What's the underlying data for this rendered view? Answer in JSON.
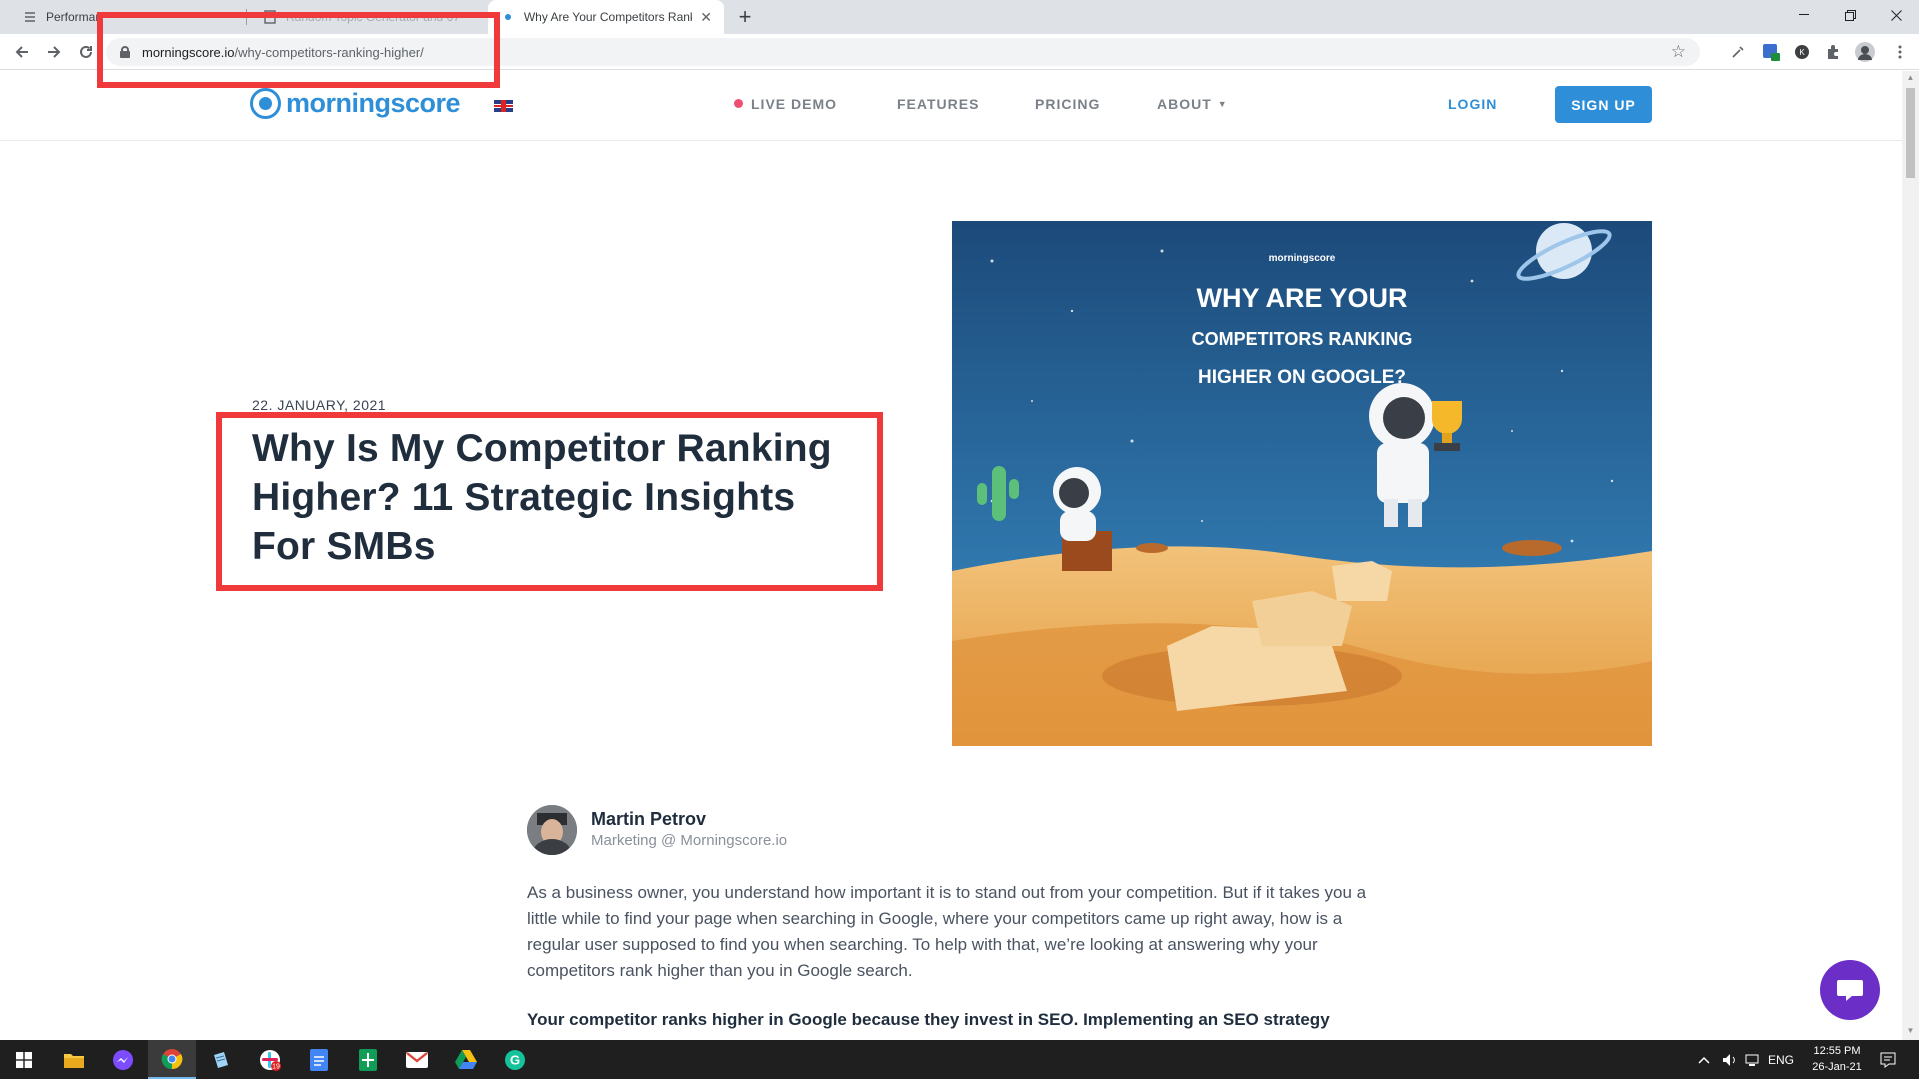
{
  "browser": {
    "tabs": [
      {
        "label": "Performan",
        "active": false
      },
      {
        "label": "Random Topic Generator and 67",
        "active": false
      },
      {
        "label": "Why Are Your Competitors Rank",
        "active": true
      }
    ],
    "url_host": "morningscore.io",
    "url_path": "/why-competitors-ranking-higher/"
  },
  "site": {
    "logo_text": "morningscore",
    "nav": {
      "live_demo": "LIVE DEMO",
      "features": "FEATURES",
      "pricing": "PRICING",
      "about": "ABOUT",
      "login": "LOGIN",
      "signup": "SIGN UP"
    },
    "colors": {
      "brand_blue": "#2e8fd8",
      "live_dot": "#ee4e6f",
      "annotation_red": "#f0393a",
      "chat": "#6b2fc8"
    }
  },
  "post": {
    "date": "22. JANUARY, 2021",
    "title": "Why Is My Competitor Ranking Higher? 11 Strategic Insights For SMBs",
    "hero": {
      "brand": "morningscore",
      "line1": "WHY ARE YOUR",
      "line2": "COMPETITORS RANKING",
      "line3": "HIGHER ON GOOGLE?"
    },
    "author": {
      "name": "Martin Petrov",
      "role": "Marketing @ Morningscore.io"
    },
    "paragraph1": "As a business owner, you understand how important it is to stand out from your competition. But if it takes you a little while to find your page when searching in Google, where your competitors came up right away, how is a regular user supposed to find you when searching. To help with that, we’re looking at answering why your competitors rank higher than you in Google search.",
    "paragraph2": "Your competitor ranks higher in Google because they invest in SEO. Implementing an SEO strategy"
  },
  "taskbar": {
    "lang": "ENG",
    "time": "12:55 PM",
    "date": "26-Jan-21",
    "calendar_badge": "19"
  }
}
